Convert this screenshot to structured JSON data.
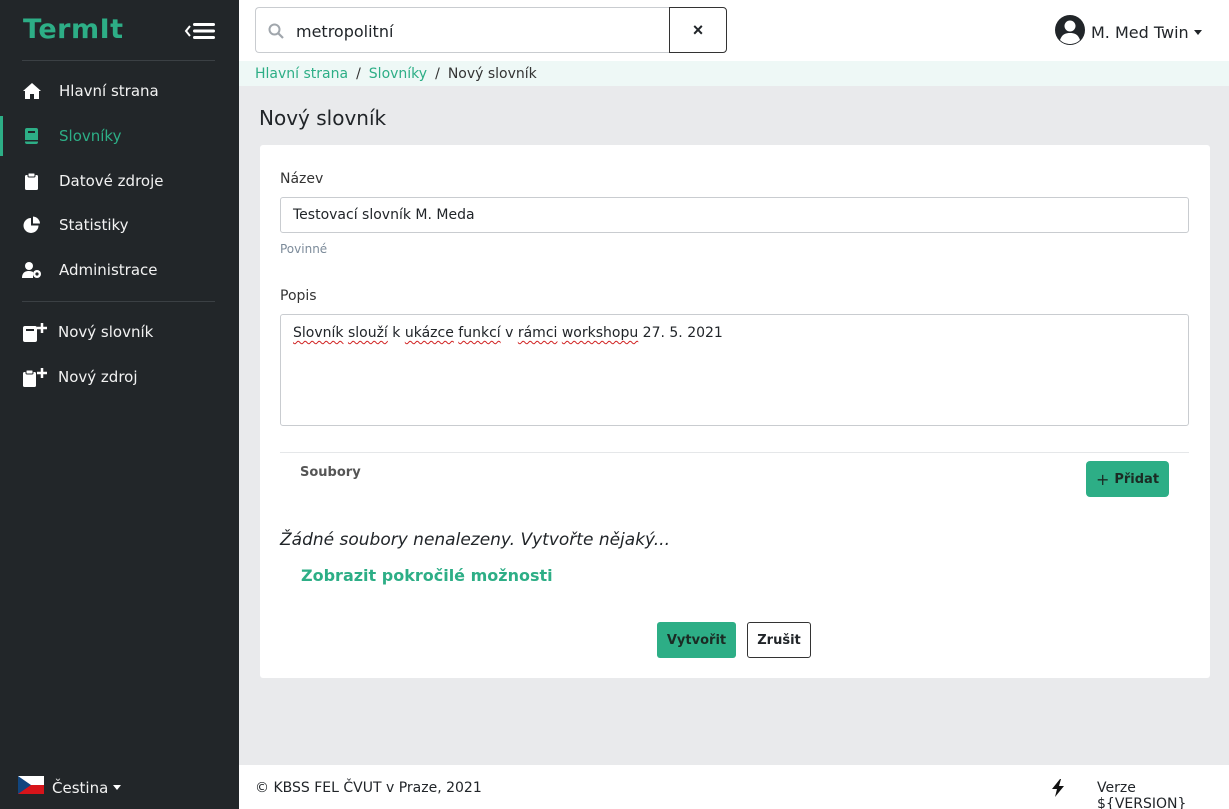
{
  "app": {
    "brand": "TermIt"
  },
  "sidebar": {
    "items": [
      {
        "label": "Hlavní strana",
        "icon": "home-icon"
      },
      {
        "label": "Slovníky",
        "icon": "book-icon",
        "active": true
      },
      {
        "label": "Datové zdroje",
        "icon": "clipboard-icon"
      },
      {
        "label": "Statistiky",
        "icon": "pie-chart-icon"
      },
      {
        "label": "Administrace",
        "icon": "user-cog-icon"
      },
      {
        "label": "Nový slovník",
        "icon": "add-vocabulary-icon"
      },
      {
        "label": "Nový zdroj",
        "icon": "add-resource-icon"
      }
    ],
    "language": "Čestina"
  },
  "search": {
    "value": "metropolitní",
    "clear_label": "×"
  },
  "user": {
    "name": "M. Med Twin"
  },
  "breadcrumb": {
    "home": "Hlavní strana",
    "vocabularies": "Slovníky",
    "current": "Nový slovník"
  },
  "page": {
    "title": "Nový slovník"
  },
  "form": {
    "name_label": "Název",
    "name_value": "Testovací slovník M. Meda",
    "name_hint": "Povinné",
    "description_label": "Popis",
    "description_value": "Slovník slouží k ukázce funkcí v rámci workshopu 27. 5. 2021",
    "files_label": "Soubory",
    "add_label": "Přidat",
    "no_files": "Žádné soubory nenalezeny. Vytvořte nějaký...",
    "advanced_link": "Zobrazit pokročilé možnosti",
    "create_label": "Vytvořit",
    "cancel_label": "Zrušit"
  },
  "footer": {
    "copyright": "© KBSS FEL ČVUT v Praze, 2021",
    "version": "Verze ${VERSION}"
  },
  "colors": {
    "accent": "#2dae86",
    "sidebar_bg": "#222629",
    "page_bg": "#e9eaec"
  }
}
